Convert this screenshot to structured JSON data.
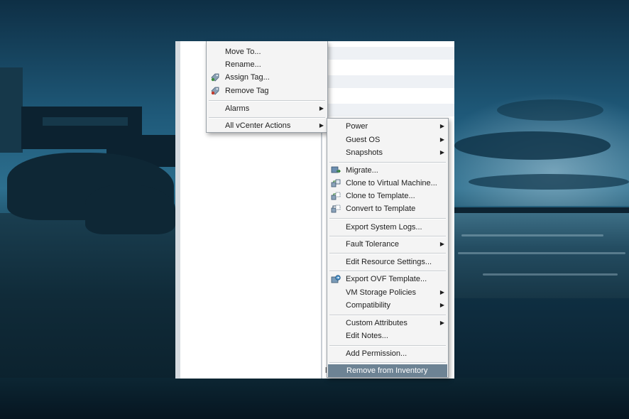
{
  "context_menu": {
    "items": [
      {
        "label": "Move To..."
      },
      {
        "label": "Rename..."
      },
      {
        "label": "Assign Tag...",
        "icon": "assign-tag-icon"
      },
      {
        "label": "Remove Tag",
        "icon": "remove-tag-icon"
      },
      {
        "label": "Alarms",
        "has_submenu": true
      },
      {
        "label": "All vCenter Actions",
        "has_submenu": true
      }
    ]
  },
  "submenu": {
    "items": [
      {
        "label": "Power",
        "has_submenu": true
      },
      {
        "label": "Guest OS",
        "has_submenu": true
      },
      {
        "label": "Snapshots",
        "has_submenu": true
      },
      {
        "label": "Migrate...",
        "icon": "migrate-icon"
      },
      {
        "label": "Clone to Virtual Machine...",
        "icon": "clone-vm-icon"
      },
      {
        "label": "Clone to Template...",
        "icon": "clone-template-icon"
      },
      {
        "label": "Convert to Template",
        "icon": "convert-template-icon"
      },
      {
        "label": "Export System Logs..."
      },
      {
        "label": "Fault Tolerance",
        "has_submenu": true
      },
      {
        "label": "Edit Resource Settings..."
      },
      {
        "label": "Export OVF Template...",
        "icon": "export-ovf-icon"
      },
      {
        "label": "VM Storage Policies",
        "has_submenu": true
      },
      {
        "label": "Compatibility",
        "has_submenu": true
      },
      {
        "label": "Custom Attributes",
        "has_submenu": true
      },
      {
        "label": "Edit Notes..."
      },
      {
        "label": "Add Permission..."
      },
      {
        "label": "Remove from Inventory",
        "highlighted": true
      }
    ]
  },
  "submenu_arrow": "▶",
  "status_char": "l",
  "colors": {
    "menu_bg": "#f4f4f4",
    "highlight_bg": "#6d8394",
    "highlight_text": "#ffffff"
  }
}
